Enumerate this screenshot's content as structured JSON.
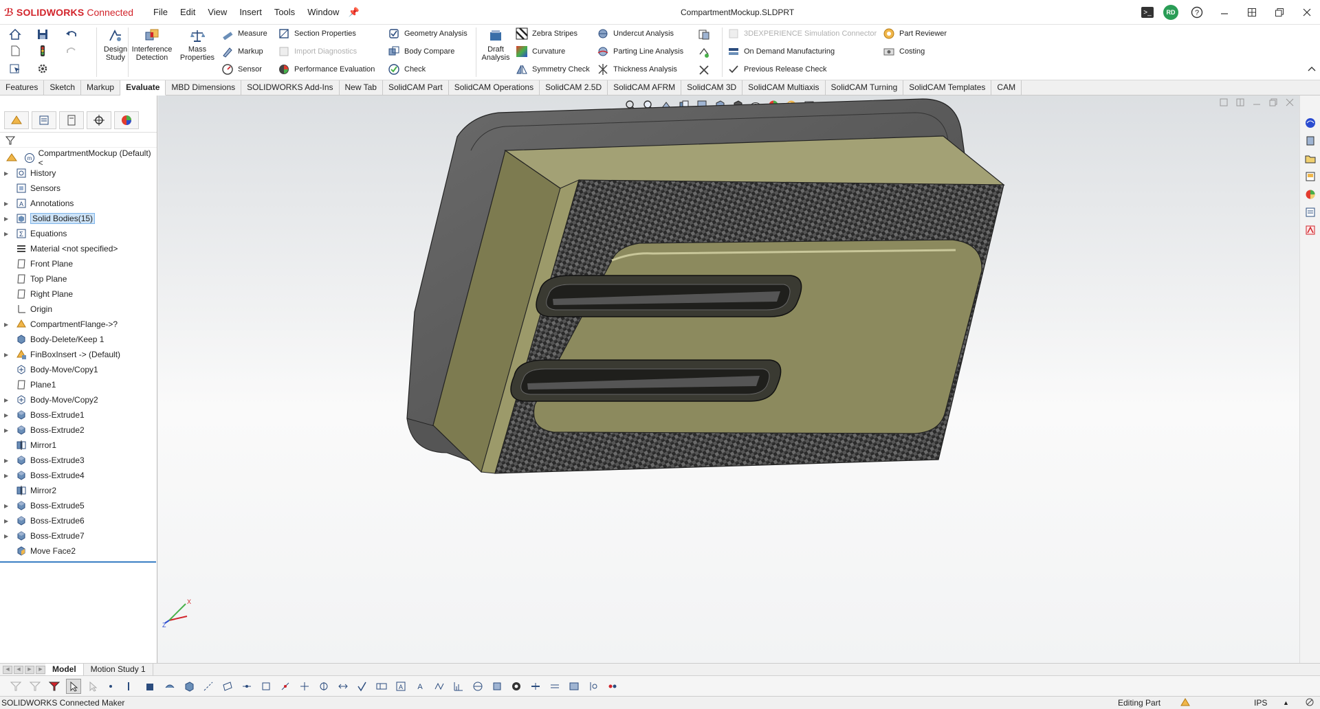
{
  "app": {
    "logo_brand": "SOLIDWORKS",
    "logo_suffix": "Connected",
    "document_title": "CompartmentMockup.SLDPRT",
    "user_initials": "RD"
  },
  "menu": [
    "File",
    "Edit",
    "View",
    "Insert",
    "Tools",
    "Window"
  ],
  "ribbon": {
    "design_study": "Design Study",
    "interference_detection": "Interference Detection",
    "mass_properties": "Mass Properties",
    "measure": "Measure",
    "markup": "Markup",
    "sensor": "Sensor",
    "section_properties": "Section Properties",
    "import_diagnostics": "Import Diagnostics",
    "performance_evaluation": "Performance Evaluation",
    "geometry_analysis": "Geometry Analysis",
    "body_compare": "Body Compare",
    "check": "Check",
    "draft_analysis": "Draft Analysis",
    "zebra_stripes": "Zebra Stripes",
    "curvature": "Curvature",
    "symmetry_check": "Symmetry Check",
    "undercut_analysis": "Undercut Analysis",
    "parting_line_analysis": "Parting Line Analysis",
    "thickness_analysis": "Thickness Analysis",
    "simulation_connector": "3DEXPERIENCE Simulation Connector",
    "on_demand_manufacturing": "On Demand Manufacturing",
    "previous_release_check": "Previous Release Check",
    "part_reviewer": "Part Reviewer",
    "costing": "Costing"
  },
  "tabs": [
    "Features",
    "Sketch",
    "Markup",
    "Evaluate",
    "MBD Dimensions",
    "SOLIDWORKS Add-Ins",
    "New Tab",
    "SolidCAM Part",
    "SolidCAM Operations",
    "SolidCAM 2.5D",
    "SolidCAM AFRM",
    "SolidCAM 3D",
    "SolidCAM Multiaxis",
    "SolidCAM Turning",
    "SolidCAM Templates",
    "CAM"
  ],
  "active_tab": "Evaluate",
  "tree": {
    "root": "CompartmentMockup (Default) <",
    "items": [
      {
        "label": "History",
        "expand": true,
        "icon": "history-icon"
      },
      {
        "label": "Sensors",
        "expand": false,
        "icon": "sensor-icon"
      },
      {
        "label": "Annotations",
        "expand": true,
        "icon": "annotations-icon"
      },
      {
        "label": "Solid Bodies(15)",
        "expand": true,
        "icon": "solid-bodies-icon",
        "selected": true
      },
      {
        "label": "Equations",
        "expand": true,
        "icon": "equations-icon"
      },
      {
        "label": "Material <not specified>",
        "expand": false,
        "icon": "material-icon"
      },
      {
        "label": "Front Plane",
        "expand": false,
        "icon": "plane-icon"
      },
      {
        "label": "Top Plane",
        "expand": false,
        "icon": "plane-icon"
      },
      {
        "label": "Right Plane",
        "expand": false,
        "icon": "plane-icon"
      },
      {
        "label": "Origin",
        "expand": false,
        "icon": "origin-icon"
      },
      {
        "label": "CompartmentFlange->?",
        "expand": true,
        "icon": "derived-part-icon"
      },
      {
        "label": "Body-Delete/Keep 1",
        "expand": false,
        "icon": "body-delete-icon"
      },
      {
        "label": "FinBoxInsert -> (Default)",
        "expand": true,
        "icon": "insert-part-icon"
      },
      {
        "label": "Body-Move/Copy1",
        "expand": false,
        "icon": "move-copy-icon"
      },
      {
        "label": "Plane1",
        "expand": false,
        "icon": "plane-icon"
      },
      {
        "label": "Body-Move/Copy2",
        "expand": true,
        "icon": "move-copy-icon"
      },
      {
        "label": "Boss-Extrude1",
        "expand": true,
        "icon": "extrude-icon"
      },
      {
        "label": "Boss-Extrude2",
        "expand": true,
        "icon": "extrude-icon"
      },
      {
        "label": "Mirror1",
        "expand": false,
        "icon": "mirror-icon"
      },
      {
        "label": "Boss-Extrude3",
        "expand": true,
        "icon": "extrude-icon"
      },
      {
        "label": "Boss-Extrude4",
        "expand": true,
        "icon": "extrude-icon"
      },
      {
        "label": "Mirror2",
        "expand": false,
        "icon": "mirror-icon"
      },
      {
        "label": "Boss-Extrude5",
        "expand": true,
        "icon": "extrude-icon"
      },
      {
        "label": "Boss-Extrude6",
        "expand": true,
        "icon": "extrude-icon"
      },
      {
        "label": "Boss-Extrude7",
        "expand": true,
        "icon": "extrude-icon"
      },
      {
        "label": "Move Face2",
        "expand": false,
        "icon": "move-face-icon"
      }
    ]
  },
  "model_tabs": [
    "Model",
    "Motion Study 1"
  ],
  "status": {
    "left": "SOLIDWORKS Connected Maker",
    "mode": "Editing Part",
    "units": "IPS"
  },
  "colors": {
    "brand_red": "#d2232a",
    "olive_body": "#8f8e62",
    "carbon": "#3a3a3a",
    "selection_blue": "#cde3f7"
  }
}
